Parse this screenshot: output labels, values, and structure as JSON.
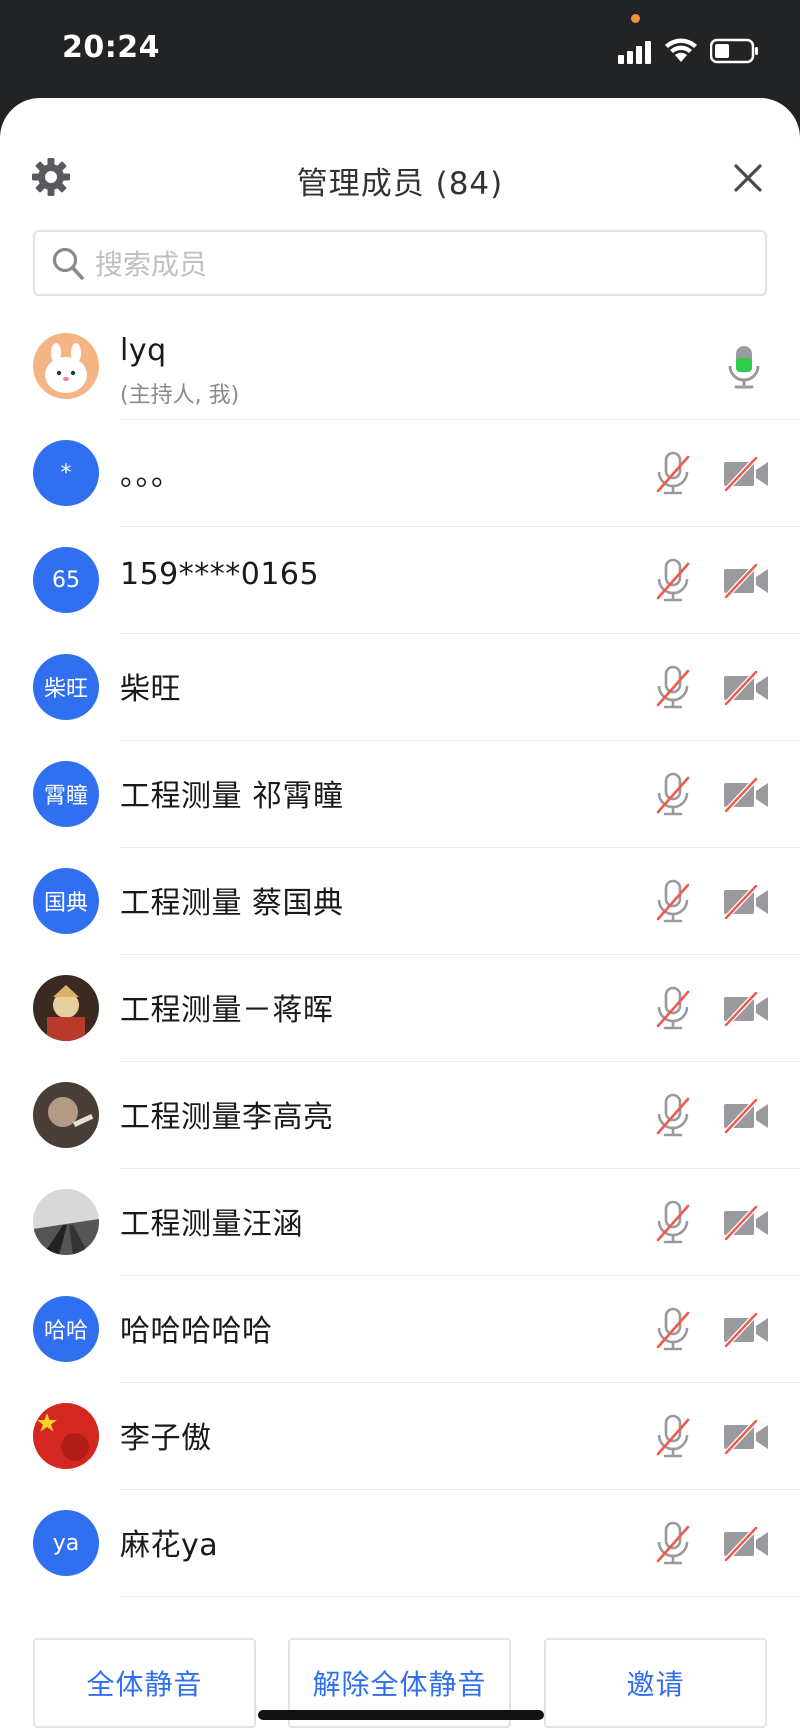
{
  "status_bar": {
    "time": "20:24"
  },
  "header": {
    "title": "管理成员 (84)"
  },
  "search": {
    "placeholder": "搜索成员"
  },
  "members": [
    {
      "avatar_text": "",
      "avatar_kind": "bunny",
      "name": "lyq",
      "subtitle": "(主持人, 我)",
      "mic": "mic-on-icon",
      "host": true
    },
    {
      "avatar_text": "*",
      "avatar_kind": "blue",
      "name": "。。。",
      "mic": "mic-muted-icon",
      "cam": "camera-off-icon"
    },
    {
      "avatar_text": "65",
      "avatar_kind": "blue",
      "name": "159****0165",
      "mic": "mic-muted-icon",
      "cam": "camera-off-icon"
    },
    {
      "avatar_text": "柴旺",
      "avatar_kind": "blue",
      "name": "柴旺",
      "mic": "mic-muted-icon",
      "cam": "camera-off-icon"
    },
    {
      "avatar_text": "霄瞳",
      "avatar_kind": "blue",
      "name": "工程测量  祁霄瞳",
      "mic": "mic-muted-icon",
      "cam": "camera-off-icon"
    },
    {
      "avatar_text": "国典",
      "avatar_kind": "blue",
      "name": "工程测量 蔡国典",
      "mic": "mic-muted-icon",
      "cam": "camera-off-icon"
    },
    {
      "avatar_text": "",
      "avatar_kind": "photo-cartoon",
      "name": "工程测量－蒋晖",
      "mic": "mic-muted-icon",
      "cam": "camera-off-icon"
    },
    {
      "avatar_text": "",
      "avatar_kind": "photo-dark",
      "name": "工程测量李高亮",
      "mic": "mic-muted-icon",
      "cam": "camera-off-icon"
    },
    {
      "avatar_text": "",
      "avatar_kind": "photo-bw",
      "name": "工程测量汪涵",
      "mic": "mic-muted-icon",
      "cam": "camera-off-icon"
    },
    {
      "avatar_text": "哈哈",
      "avatar_kind": "blue",
      "name": "哈哈哈哈哈",
      "mic": "mic-muted-icon",
      "cam": "camera-off-icon"
    },
    {
      "avatar_text": "",
      "avatar_kind": "photo-flag",
      "name": "李子傲",
      "mic": "mic-muted-icon",
      "cam": "camera-off-icon"
    },
    {
      "avatar_text": "ya",
      "avatar_kind": "blue",
      "name": "麻花ya",
      "mic": "mic-muted-icon",
      "cam": "camera-off-icon"
    }
  ],
  "footer": {
    "mute_all": "全体静音",
    "unmute_all": "解除全体静音",
    "invite": "邀请"
  },
  "colors": {
    "accent": "#2f6ff0",
    "muted_red": "#f05a4a",
    "mic_active": "#2ecc4a"
  }
}
